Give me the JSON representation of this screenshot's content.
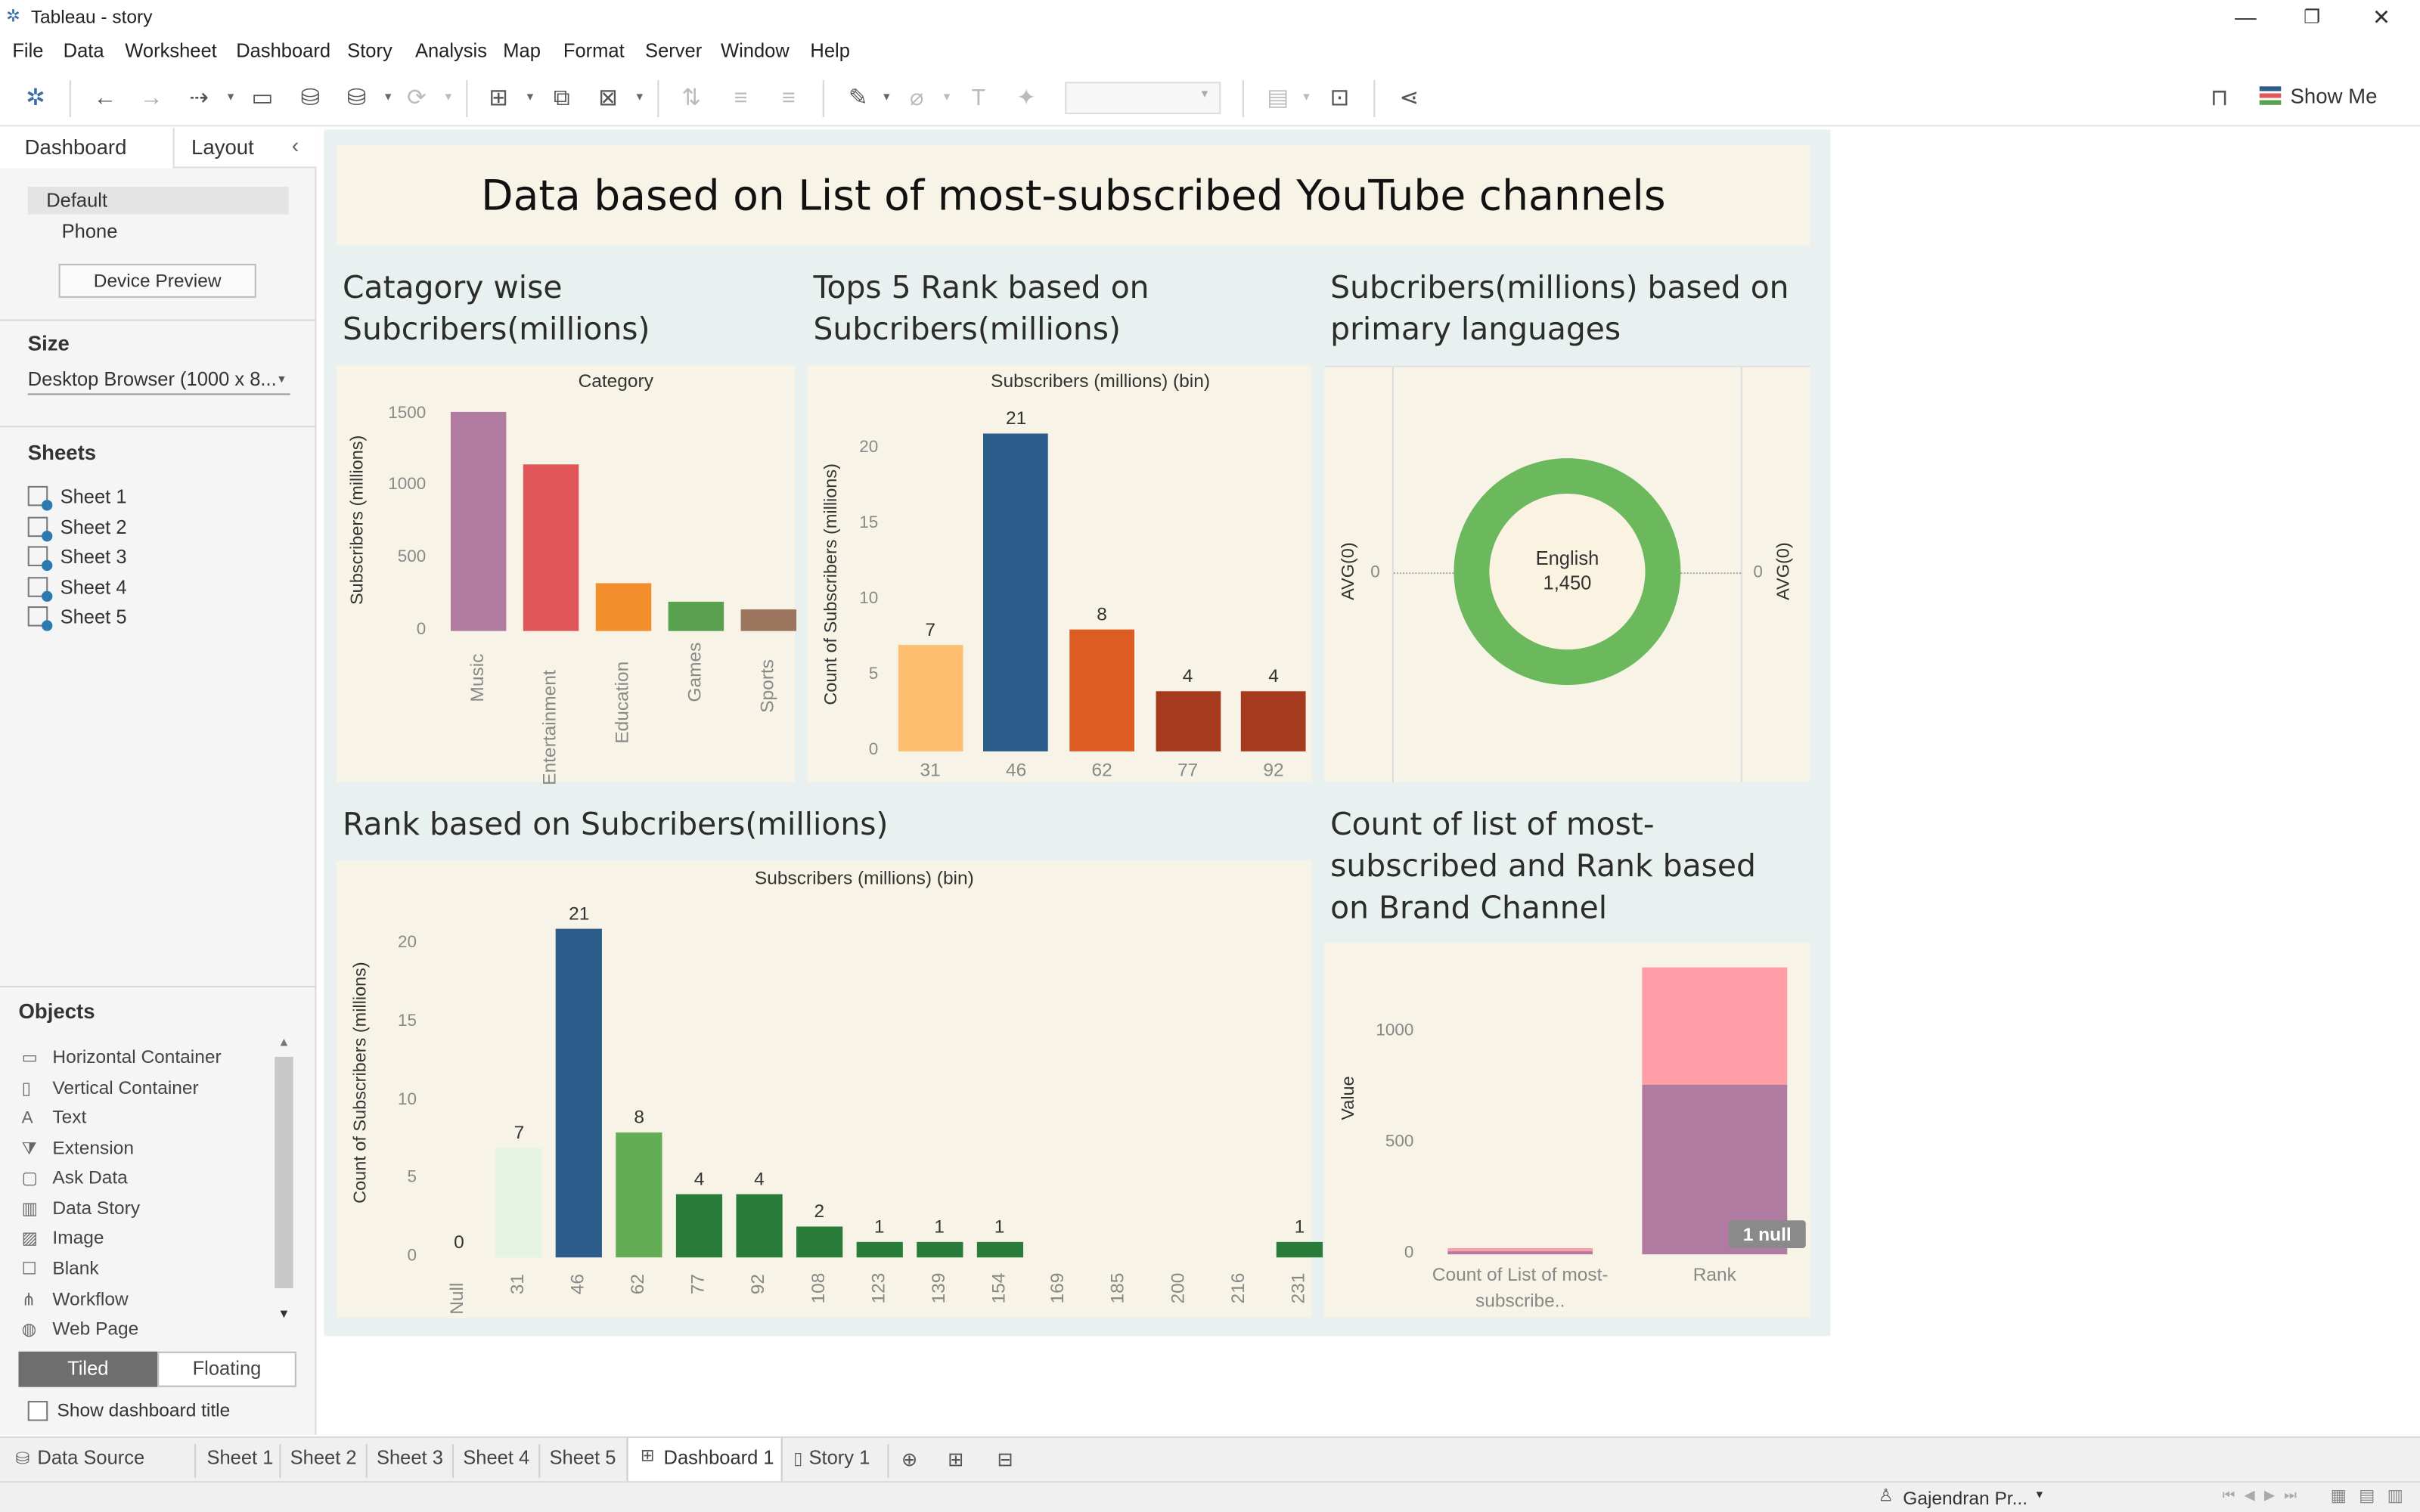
{
  "window": {
    "title": "Tableau - story"
  },
  "menu": [
    "File",
    "Data",
    "Worksheet",
    "Dashboard",
    "Story",
    "Analysis",
    "Map",
    "Format",
    "Server",
    "Window",
    "Help"
  ],
  "toolbar": {
    "show_me": "Show Me"
  },
  "left_panel": {
    "tabs": [
      "Dashboard",
      "Layout"
    ],
    "device": {
      "default": "Default",
      "phone": "Phone",
      "preview_button": "Device Preview"
    },
    "size": {
      "heading": "Size",
      "value": "Desktop Browser (1000 x 8..."
    },
    "sheets": {
      "heading": "Sheets",
      "items": [
        "Sheet 1",
        "Sheet 2",
        "Sheet 3",
        "Sheet 4",
        "Sheet 5"
      ]
    },
    "objects": {
      "heading": "Objects",
      "items": [
        "Horizontal Container",
        "Vertical Container",
        "Text",
        "Extension",
        "Ask Data",
        "Data Story",
        "Image",
        "Blank",
        "Workflow",
        "Web Page"
      ],
      "tiled": "Tiled",
      "floating": "Floating",
      "show_title": "Show dashboard title"
    }
  },
  "dashboard": {
    "title": "Data based on List of most-subscribed YouTube channels",
    "zone1_title": "Catagory wise Subcribers(millions)",
    "zone2_title": "Tops 5 Rank based on Subcribers(millions)",
    "zone3_title": "Subcribers(millions) based on primary languages",
    "zone4_title": "Rank based on Subcribers(millions)",
    "zone5_title": "Count of list of most-subscribed and Rank based on Brand Channel"
  },
  "chart_data": [
    {
      "type": "bar",
      "header": "Category",
      "ylabel": "Subscribers (millions)",
      "categories": [
        "Music",
        "Entertainment",
        "Education",
        "Games",
        "Sports"
      ],
      "values": [
        1520,
        1150,
        330,
        200,
        150
      ],
      "colors": [
        "#b07aa1",
        "#e15759",
        "#f28e2b",
        "#59a14f",
        "#9c755f"
      ],
      "yticks": [
        0,
        500,
        1000,
        1500
      ],
      "ylim": [
        0,
        1560
      ]
    },
    {
      "type": "bar",
      "header": "Subscribers (millions) (bin)",
      "ylabel": "Count of Subscribers (millions)",
      "categories": [
        "31",
        "46",
        "62",
        "77",
        "92"
      ],
      "values": [
        7,
        21,
        8,
        4,
        4
      ],
      "colors": [
        "#fdbf6f",
        "#2c5c8a",
        "#dd5c24",
        "#a63a1e",
        "#a63a1e"
      ],
      "yticks": [
        0,
        5,
        10,
        15,
        20
      ],
      "ylim": [
        0,
        22
      ]
    },
    {
      "type": "pie",
      "yleft": "AVG(0)",
      "yright": "AVG(0)",
      "zero": "0",
      "slices": [
        {
          "label": "English",
          "value": "1,450",
          "color": "#6cb85c"
        }
      ]
    },
    {
      "type": "bar",
      "header": "Subscribers (millions) (bin)",
      "ylabel": "Count of Subscribers (millions)",
      "categories": [
        "Null",
        "31",
        "46",
        "62",
        "77",
        "92",
        "108",
        "123",
        "139",
        "154",
        "169",
        "185",
        "200",
        "216",
        "231"
      ],
      "values": [
        0,
        7,
        21,
        8,
        4,
        4,
        2,
        1,
        1,
        1,
        null,
        null,
        null,
        null,
        1
      ],
      "labels": [
        "0",
        "7",
        "21",
        "8",
        "4",
        "4",
        "2",
        "1",
        "1",
        "1",
        "",
        "",
        "",
        "",
        "1"
      ],
      "colors": [
        "#ffffff",
        "#e6f4e3",
        "#2c5c8a",
        "#63ad57",
        "#2a7c3a",
        "#2a7c3a",
        "#2a7c3a",
        "#2a7c3a",
        "#2a7c3a",
        "#2a7c3a",
        "#2a7c3a",
        "#2a7c3a",
        "#2a7c3a",
        "#2a7c3a",
        "#2a7c3a"
      ],
      "yticks": [
        0,
        5,
        10,
        15,
        20
      ],
      "ylim": [
        0,
        21.8
      ]
    },
    {
      "type": "bar",
      "stacked": true,
      "ylabel": "Value",
      "categories": [
        "Count of List of most-subscribe..",
        "Rank"
      ],
      "series": [
        {
          "values": [
            15,
            765
          ],
          "color": "#b07aa1"
        },
        {
          "values": [
            10,
            525
          ],
          "color": "#ff9da7"
        }
      ],
      "yticks": [
        0,
        500,
        1000
      ],
      "ylim": [
        0,
        1330
      ],
      "null_badge": "1 null"
    }
  ],
  "bottom_tabs": {
    "data_source": "Data Source",
    "sheets": [
      "Sheet 1",
      "Sheet 2",
      "Sheet 3",
      "Sheet 4",
      "Sheet 5"
    ],
    "active": "Dashboard 1",
    "story": "Story 1"
  },
  "status": {
    "user": "Gajendran Pr..."
  }
}
